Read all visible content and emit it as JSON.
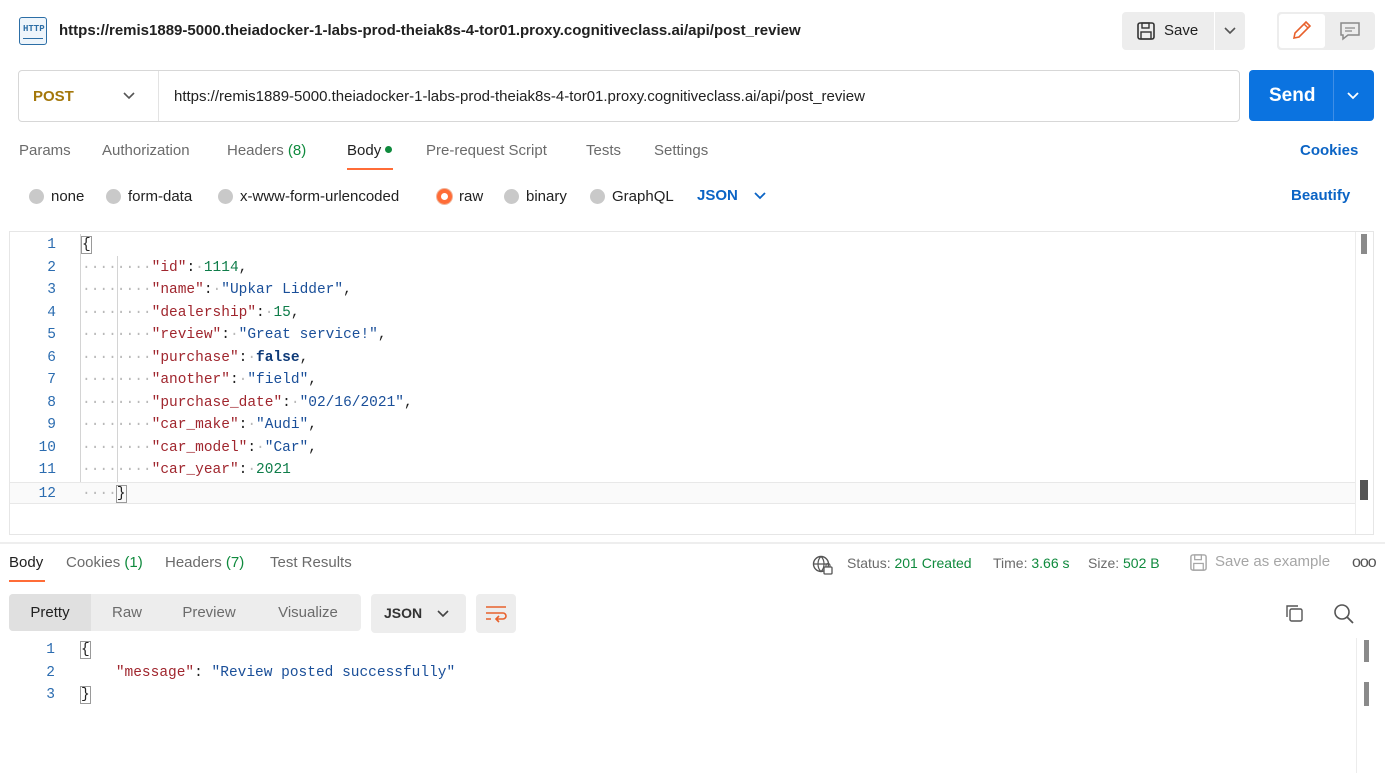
{
  "header": {
    "icon_text": "HTTP",
    "url": "https://remis1889-5000.theiadocker-1-labs-prod-theiak8s-4-tor01.proxy.cognitiveclass.ai/api/post_review",
    "save_label": "Save"
  },
  "request": {
    "method": "POST",
    "url": "https://remis1889-5000.theiadocker-1-labs-prod-theiak8s-4-tor01.proxy.cognitiveclass.ai/api/post_review",
    "send_label": "Send"
  },
  "request_tabs": {
    "params": "Params",
    "authorization": "Authorization",
    "headers": "Headers",
    "headers_count": "(8)",
    "body": "Body",
    "prerequest": "Pre-request Script",
    "tests": "Tests",
    "settings": "Settings",
    "cookies": "Cookies",
    "active": "Body"
  },
  "body_types": {
    "none": "none",
    "form_data": "form-data",
    "urlencoded": "x-www-form-urlencoded",
    "raw": "raw",
    "binary": "binary",
    "graphql": "GraphQL",
    "selected": "raw",
    "language": "JSON",
    "beautify": "Beautify"
  },
  "request_body": {
    "line_numbers": [
      "1",
      "2",
      "3",
      "4",
      "5",
      "6",
      "7",
      "8",
      "9",
      "10",
      "11",
      "12"
    ],
    "open_brace": "{",
    "close_brace": "}",
    "fields": [
      {
        "key": "\"id\"",
        "value": "1114",
        "type": "num",
        "comma": ","
      },
      {
        "key": "\"name\"",
        "value": "\"Upkar Lidder\"",
        "type": "str",
        "comma": ","
      },
      {
        "key": "\"dealership\"",
        "value": "15",
        "type": "num",
        "comma": ","
      },
      {
        "key": "\"review\"",
        "value": "\"Great service!\"",
        "type": "str",
        "comma": ","
      },
      {
        "key": "\"purchase\"",
        "value": "false",
        "type": "kw",
        "comma": ","
      },
      {
        "key": "\"another\"",
        "value": "\"field\"",
        "type": "str",
        "comma": ","
      },
      {
        "key": "\"purchase_date\"",
        "value": "\"02/16/2021\"",
        "type": "str",
        "comma": ","
      },
      {
        "key": "\"car_make\"",
        "value": "\"Audi\"",
        "type": "str",
        "comma": ","
      },
      {
        "key": "\"car_model\"",
        "value": "\"Car\"",
        "type": "str",
        "comma": ","
      },
      {
        "key": "\"car_year\"",
        "value": "2021",
        "type": "num",
        "comma": ""
      }
    ]
  },
  "response_tabs": {
    "body": "Body",
    "cookies": "Cookies",
    "cookies_count": "(1)",
    "headers": "Headers",
    "headers_count": "(7)",
    "test_results": "Test Results",
    "active": "Body"
  },
  "response_meta": {
    "status_label": "Status:",
    "status_value": "201 Created",
    "time_label": "Time:",
    "time_value": "3.66 s",
    "size_label": "Size:",
    "size_value": "502 B",
    "save_example": "Save as example",
    "more": "ooo"
  },
  "response_view": {
    "pretty": "Pretty",
    "raw": "Raw",
    "preview": "Preview",
    "visualize": "Visualize",
    "active": "Pretty",
    "language": "JSON"
  },
  "response_body": {
    "line_numbers": [
      "1",
      "2",
      "3"
    ],
    "open_brace": "{",
    "close_brace": "}",
    "key": "\"message\"",
    "value": "\"Review posted successfully\""
  },
  "colors": {
    "accent": "#ff6c37",
    "primary": "#0b73e0",
    "success": "#0f8a3d"
  }
}
